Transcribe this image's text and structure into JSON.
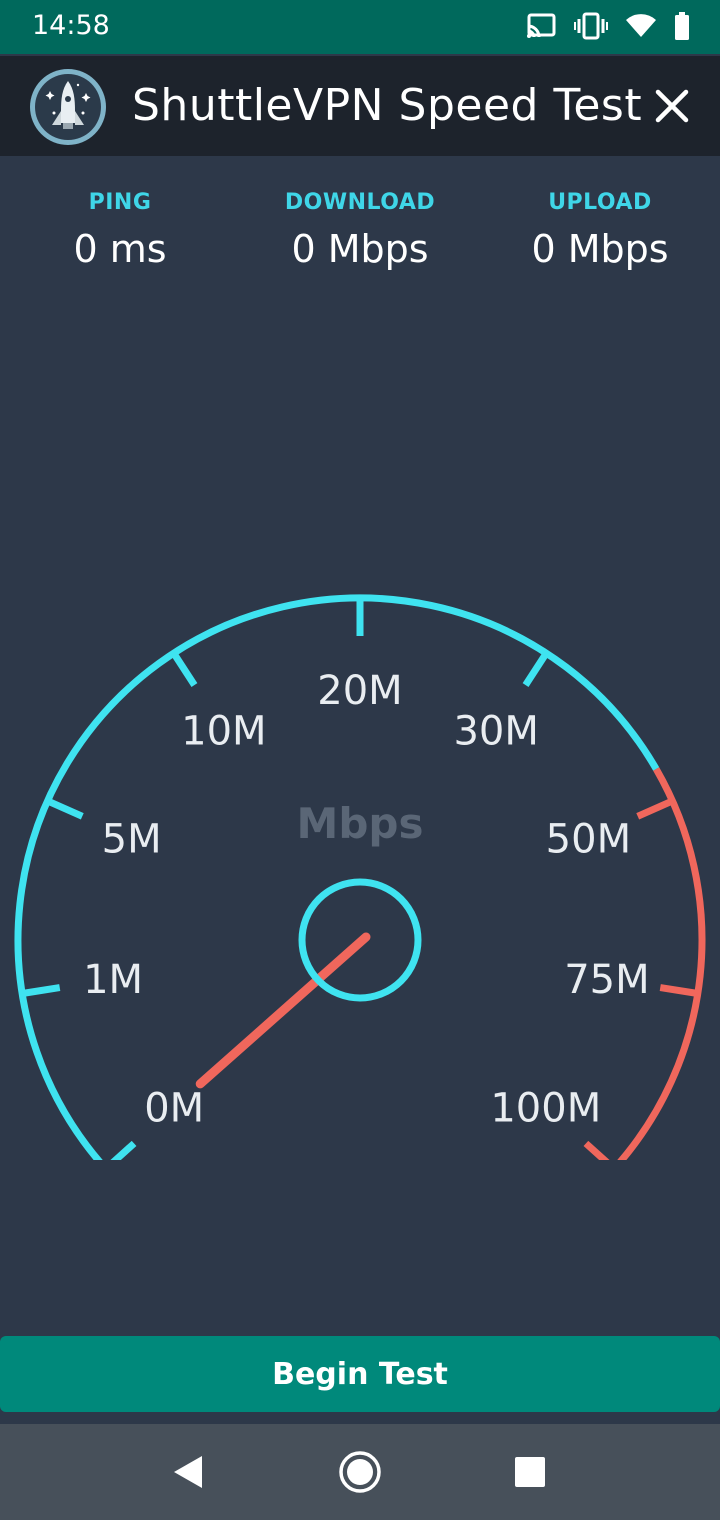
{
  "status_bar": {
    "time": "14:58",
    "icons": [
      "cast-icon",
      "vibrate-icon",
      "wifi-icon",
      "battery-icon"
    ]
  },
  "app_bar": {
    "title": "ShuttleVPN Speed Test",
    "logo": "shuttle-logo-icon",
    "close_icon": "close-icon"
  },
  "stats": {
    "ping": {
      "label": "PING",
      "value": "0 ms"
    },
    "download": {
      "label": "DOWNLOAD",
      "value": "0 Mbps"
    },
    "upload": {
      "label": "UPLOAD",
      "value": "0 Mbps"
    }
  },
  "gauge": {
    "unit": "Mbps",
    "current_value": 0,
    "ticks": [
      "0M",
      "1M",
      "5M",
      "10M",
      "20M",
      "30M",
      "50M",
      "75M",
      "100M"
    ],
    "colors": {
      "normal": "#3fe3f0",
      "high": "#f0675c",
      "needle": "#f0675c",
      "hub": "#3fe3f0"
    }
  },
  "begin_button": {
    "label": "Begin Test"
  },
  "nav_bar": {
    "icons": [
      "back-icon",
      "home-icon",
      "recents-icon"
    ]
  }
}
